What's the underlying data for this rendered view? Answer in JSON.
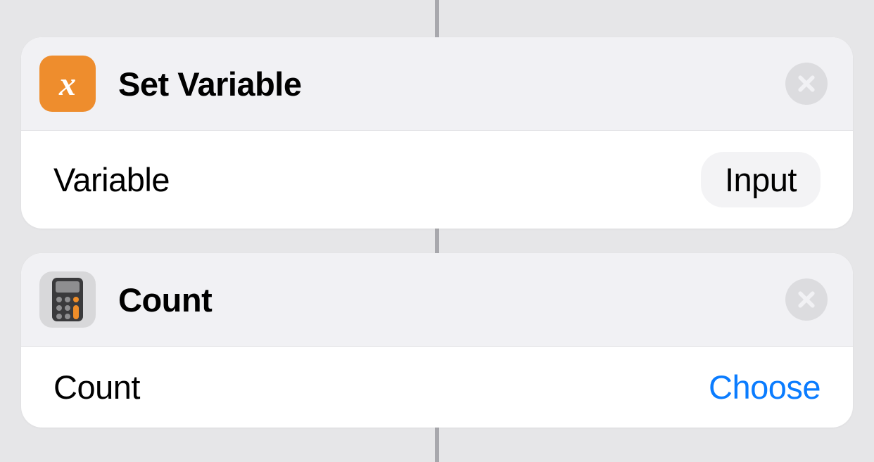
{
  "actions": [
    {
      "icon": "variable-icon",
      "iconGlyph": "x",
      "title": "Set Variable",
      "row": {
        "label": "Variable",
        "valueType": "pill",
        "value": "Input"
      }
    },
    {
      "icon": "calculator-icon",
      "title": "Count",
      "row": {
        "label": "Count",
        "valueType": "link",
        "value": "Choose"
      }
    }
  ]
}
